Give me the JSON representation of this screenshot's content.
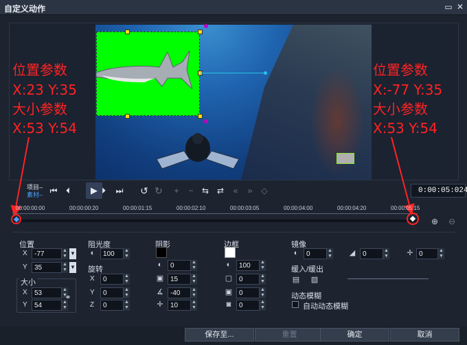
{
  "window": {
    "title": "自定义动作",
    "restore_icon": "▭",
    "close_icon": "✕"
  },
  "annotations": {
    "left": {
      "pos_label": "位置参数",
      "pos_values": "X:23  Y:35",
      "size_label": "大小参数",
      "size_values": "X:53  Y:54"
    },
    "right": {
      "pos_label": "位置参数",
      "pos_values": "X:-77  Y:35",
      "size_label": "大小参数",
      "size_values": "X:53  Y:54"
    }
  },
  "transport": {
    "project_label": "项目",
    "clip_label": "素材",
    "timecode": "0:00:05:024",
    "buttons": [
      "skip-start-icon",
      "step-back-icon",
      "play-icon",
      "step-forward-icon",
      "skip-end-icon",
      "undo-icon",
      "redo-icon"
    ]
  },
  "ruler": {
    "labels": [
      "00:00:00:00",
      "00:00:00:20",
      "00:00:01:15",
      "00:00:02:10",
      "00:00:03:05",
      "00:00:04:00",
      "00:00:04:20",
      "00:00:05:15"
    ]
  },
  "properties": {
    "position": {
      "title": "位置",
      "x": "-77",
      "y": "35",
      "x_label": "X",
      "y_label": "Y"
    },
    "size": {
      "title": "大小",
      "x": "53",
      "y": "54",
      "x_label": "X",
      "y_label": "Y"
    },
    "opacity": {
      "title": "阻光度",
      "value": "100"
    },
    "rotation": {
      "title": "旋转",
      "x": "0",
      "y": "0",
      "z": "0",
      "x_label": "X",
      "y_label": "Y",
      "z_label": "Z"
    },
    "shadow": {
      "title": "阴影",
      "color": "#000000",
      "opacity": "0",
      "size": "15",
      "angle": "-40",
      "distance": "10"
    },
    "border": {
      "title": "边框",
      "color": "#ffffff",
      "opacity": "100",
      "size": "0",
      "blur": "0",
      "offset": "0"
    },
    "mirror": {
      "title": "镜像",
      "opacity": "0",
      "fade": "0",
      "offset": "0"
    },
    "ease": {
      "title": "缓入/缓出"
    },
    "motion_blur": {
      "title": "动态模糊",
      "checkbox_label": "自动动态模糊",
      "checked": false
    }
  },
  "footer": {
    "save_to": "保存至...",
    "reset": "重置",
    "ok": "确定",
    "cancel": "取消"
  }
}
